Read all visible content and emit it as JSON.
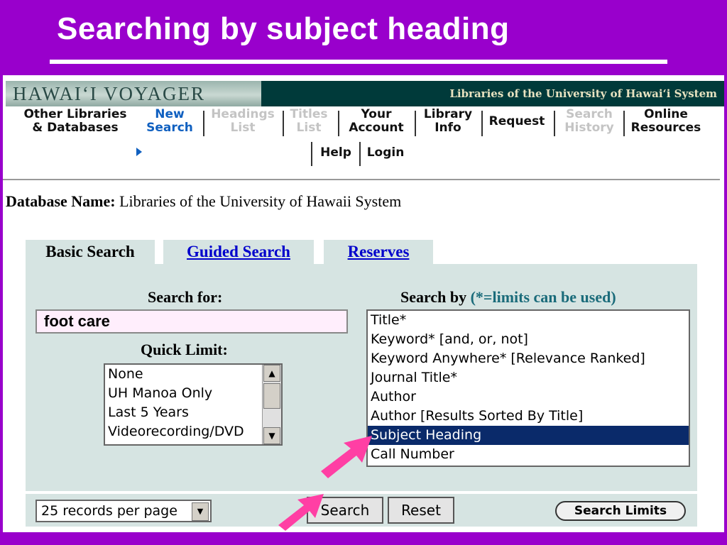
{
  "slide": {
    "title": "Searching by subject heading"
  },
  "banner": {
    "logo": "HAWAI‘I VOYAGER",
    "system": "Libraries of the University of Hawai‘i System"
  },
  "nav": {
    "other": [
      "Other Libraries",
      "& Databases"
    ],
    "new_search": [
      "New",
      "Search"
    ],
    "headings": [
      "Headings",
      "List"
    ],
    "titles": [
      "Titles",
      "List"
    ],
    "account": [
      "Your",
      "Account"
    ],
    "library": [
      "Library",
      "Info"
    ],
    "request": "Request",
    "history": [
      "Search",
      "History"
    ],
    "online": [
      "Online",
      "Resources"
    ],
    "help": "Help",
    "login": "Login"
  },
  "database": {
    "label": "Database Name:",
    "value": "Libraries of the University of Hawaii System"
  },
  "tabs": {
    "basic": "Basic Search",
    "guided": "Guided Search",
    "reserves": "Reserves"
  },
  "form": {
    "search_for_label": "Search for:",
    "search_value": "foot care",
    "quick_limit_label": "Quick Limit:",
    "quick_limit_options": [
      "None",
      "UH Manoa Only",
      "Last 5 Years",
      "Videorecording/DVD"
    ],
    "search_by_label": "Search by",
    "search_by_hint": "(*=limits can be used)",
    "search_by_options": [
      "Title*",
      "Keyword* [and, or, not]",
      "Keyword Anywhere* [Relevance Ranked]",
      "Journal Title*",
      "Author",
      "Author [Results Sorted By Title]",
      "Subject Heading",
      "Call Number"
    ],
    "search_by_selected": "Subject Heading",
    "records_per_page": "25 records per page",
    "search_button": "Search",
    "reset_button": "Reset",
    "limits_button": "Search Limits"
  },
  "colors": {
    "background": "#9900cc",
    "panel": "#d6e4e2",
    "highlight": "#0a2a6a",
    "pointer": "#ff3fa4"
  }
}
